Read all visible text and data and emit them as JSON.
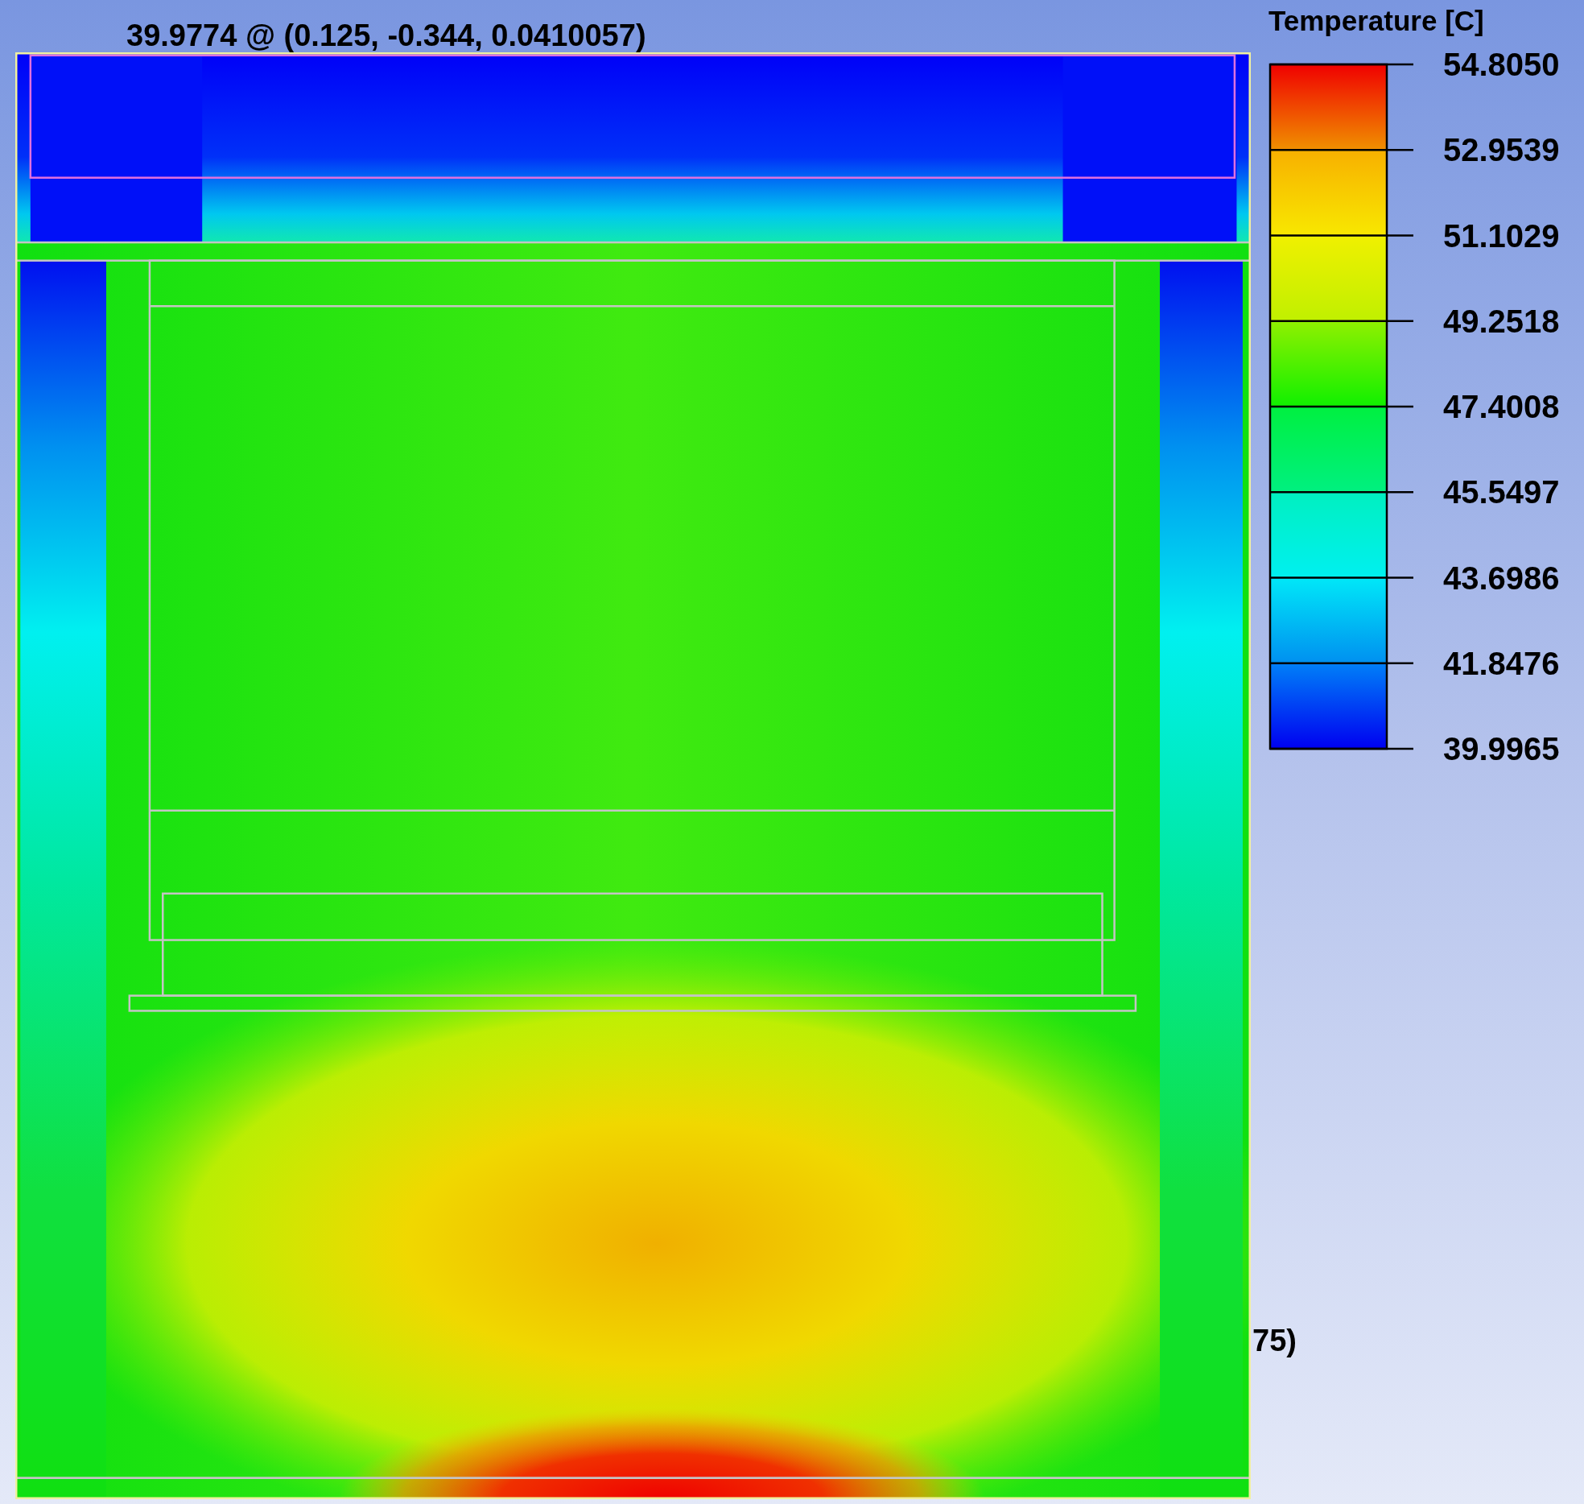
{
  "probe_label": "39.9774 @ (0.125, -0.344, 0.0410057)",
  "partial_label": "75)",
  "legend": {
    "title": "Temperature [C]",
    "labels": [
      "54.8050",
      "52.9539",
      "51.1029",
      "49.2518",
      "47.4008",
      "45.5497",
      "43.6986",
      "41.8476",
      "39.9965"
    ]
  }
}
